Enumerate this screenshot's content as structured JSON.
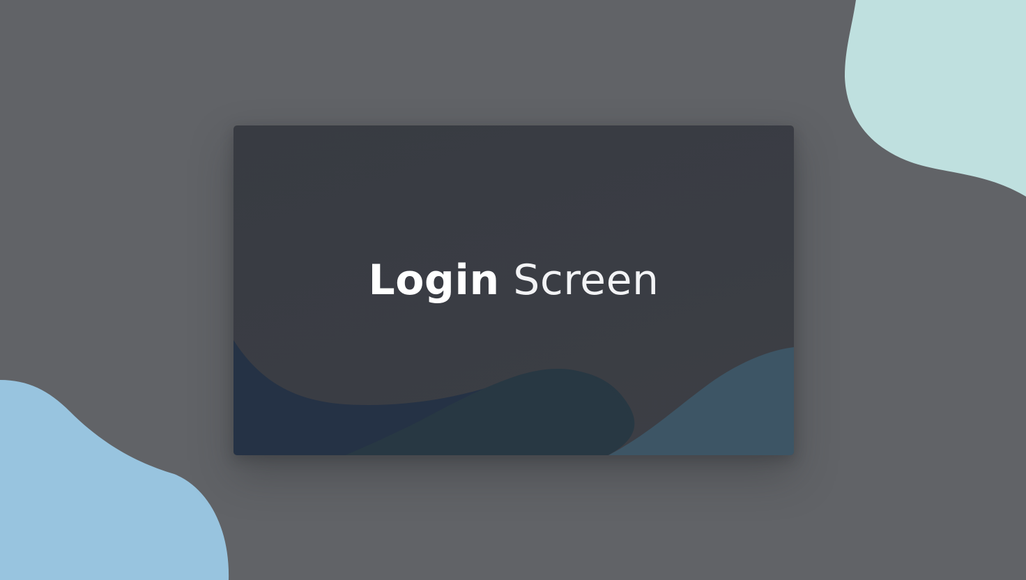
{
  "screen": {
    "title_bold": "Login",
    "title_light": " Screen"
  },
  "colors": {
    "background": "#616367",
    "card": "#393c43",
    "blob_top_right": "#bfe0df",
    "blob_bottom_left": "#98c4df",
    "wave_dark": "#253245",
    "wave_mid": "#283843",
    "wave_light": "#3d5565"
  }
}
